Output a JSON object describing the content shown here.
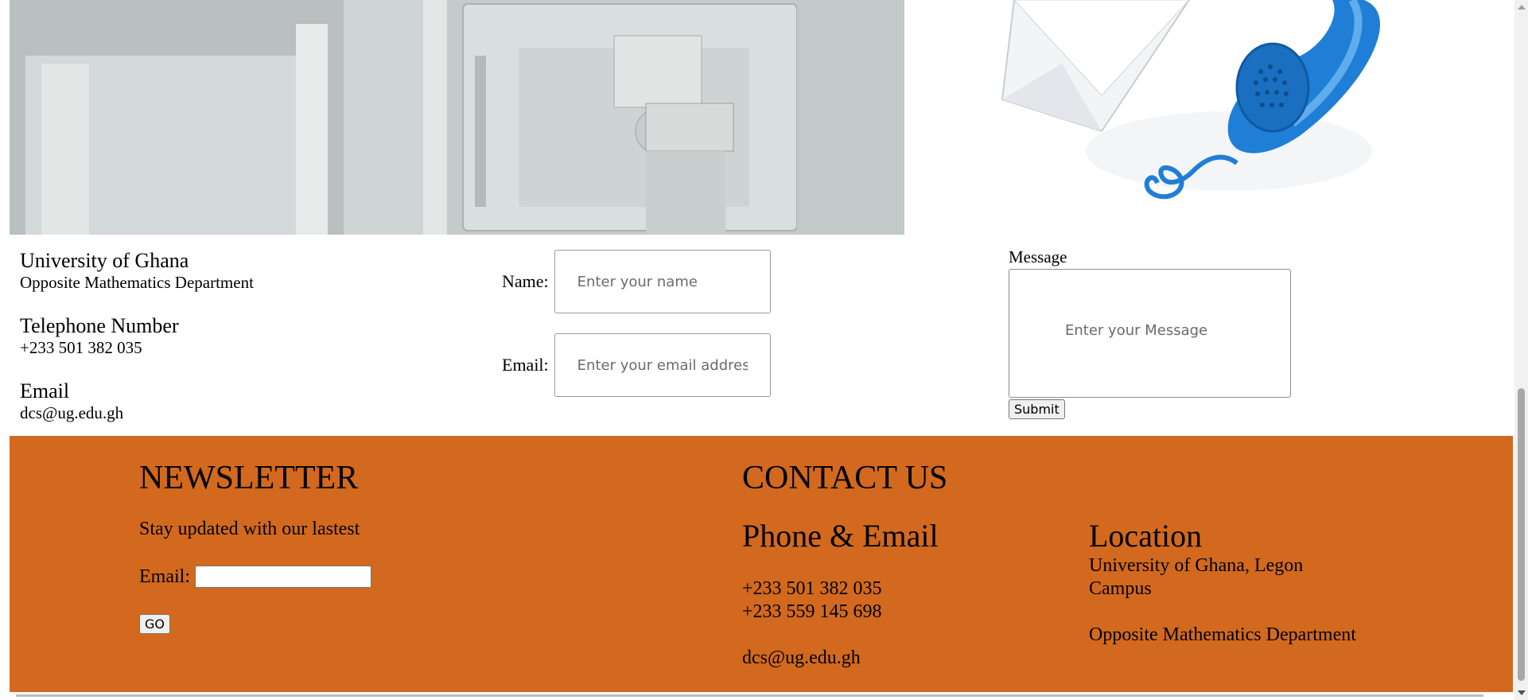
{
  "info": {
    "org_heading": "University of Ghana",
    "org_line": "Opposite Mathematics Department",
    "phone_heading": "Telephone Number",
    "phone_line": "+233 501 382 035",
    "email_heading": "Email",
    "email_line": "dcs@ug.edu.gh"
  },
  "form": {
    "name_label": "Name:",
    "name_placeholder": "Enter your name",
    "email_label": "Email:",
    "email_placeholder": "Enter your email address",
    "message_label": "Message",
    "message_placeholder": "Enter your Message",
    "submit_label": "Submit"
  },
  "footer": {
    "newsletter_title": "NEWSLETTER",
    "newsletter_text": "Stay updated with our lastest",
    "newsletter_email_label": "Email:",
    "go_label": "GO",
    "contact_title": "CONTACT US",
    "phone_email_heading": "Phone & Email",
    "phone_1": "+233 501 382 035",
    "phone_2": "+233 559 145 698",
    "email": "dcs@ug.edu.gh",
    "location_heading": "Location",
    "location_line_1": "University of Ghana, Legon",
    "location_line_2": "Campus",
    "location_line_3": "Opposite Mathematics Department",
    "background_color": "#d2691e"
  },
  "images": {
    "left_image_icon": "computer-monitors-photo",
    "right_image_icon": "envelope-telephone-icon"
  }
}
